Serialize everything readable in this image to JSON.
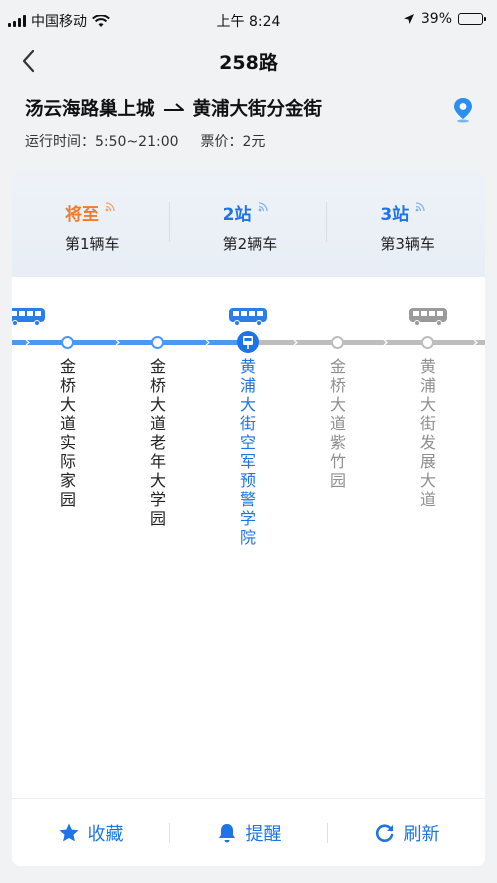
{
  "status_bar": {
    "carrier": "中国移动",
    "time": "上午 8:24",
    "battery": "39%",
    "battery_level": 0.39
  },
  "nav": {
    "title": "258路"
  },
  "route": {
    "from": "汤云海路巢上城",
    "to": "黄浦大街分金街",
    "hours": "运行时间：5:50~21:00",
    "fare": "票价：2元"
  },
  "arrivals": [
    {
      "status": "将至",
      "vehicle": "第1辆车",
      "color": "#f07b2a"
    },
    {
      "status": "2站",
      "vehicle": "第2辆车",
      "color": "#1e74e6"
    },
    {
      "status": "3站",
      "vehicle": "第3辆车",
      "color": "#1e74e6"
    }
  ],
  "stops": [
    {
      "name": "金桥大道实际家园",
      "state": "passed"
    },
    {
      "name": "金桥大道老年大学园",
      "state": "passed"
    },
    {
      "name": "黄浦大街空军预警学院",
      "state": "current"
    },
    {
      "name": "金桥大道紫竹园",
      "state": "upcoming"
    },
    {
      "name": "黄浦大街发展大道",
      "state": "upcoming"
    }
  ],
  "colors": {
    "accent": "#1e74e6",
    "passed_line": "#4a97f5",
    "upcoming_line": "#bdbdbd",
    "upcoming_text": "#8f8f8f",
    "orange": "#f07b2a"
  },
  "actions": {
    "favorite": "收藏",
    "remind": "提醒",
    "refresh": "刷新"
  }
}
